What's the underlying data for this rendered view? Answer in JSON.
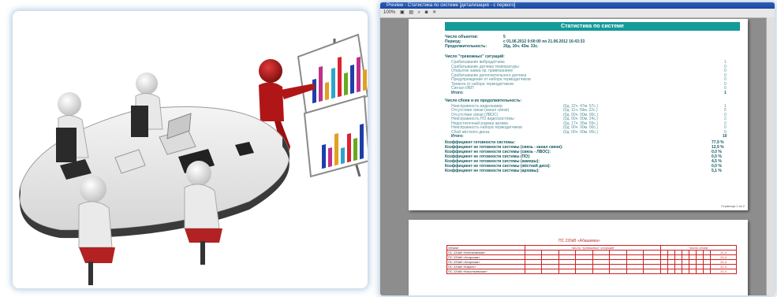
{
  "window": {
    "title": "Preview - Статистика по системе [детализация - с первого]",
    "toolbar": [
      "100%",
      "Print",
      "Save",
      "Zoom",
      "Find",
      "Close"
    ]
  },
  "report": {
    "title": "Статистика по системе",
    "objects_label": "Число объектов:",
    "objects_value": "5",
    "period_label": "Период:",
    "period_value": "с 01.06.2012 0:00:00 по 21.06.2012 16:43:33",
    "duration_label": "Продолжительность:",
    "duration_value": "20д. 16ч. 43м. 33с.",
    "alarms_header": "Число \"тревожных\" ситуаций:",
    "alarms": [
      {
        "label": "Срабатывание вибродатчика",
        "value": "1"
      },
      {
        "label": "Срабатывание датчика температуры",
        "value": "0"
      },
      {
        "label": "Открытие замка пр. привязанием",
        "value": "0"
      },
      {
        "label": "Срабатывание дополнительного датчика",
        "value": "0"
      },
      {
        "label": "Предупреждение от набора термодатчиков",
        "value": "0"
      },
      {
        "label": "Тревога от набора термодатчиков",
        "value": "0"
      },
      {
        "label": "Сигнал ИБП",
        "value": "0"
      }
    ],
    "alarms_total_label": "Итого:",
    "alarms_total": "1",
    "faults_header": "Число сбоев и их продолжительность:",
    "faults": [
      {
        "label": "Неисправность видеокамер",
        "dur": "(0д. 22ч. 47м. 57с.)",
        "value": "1"
      },
      {
        "label": "Отсутствие связи (канал связи)",
        "dur": "(0д. 11ч. 59м. 22с.)",
        "value": "5"
      },
      {
        "label": "Отсутствие связи (ЛВОС)",
        "dur": "(0д. 00ч. 00м. 00с.)",
        "value": "0"
      },
      {
        "label": "Неисправность ПО видеосистемы",
        "dur": "(0д. 00ч. 00м. 24с.)",
        "value": "2"
      },
      {
        "label": "Недостаточный размер архива",
        "dur": "(0д. 17ч. 35м. 55с.)",
        "value": "2"
      },
      {
        "label": "Неисправность набора термодатчиков",
        "dur": "(0д. 00ч. 00м. 00с.)",
        "value": "0"
      },
      {
        "label": "Сбой жёсткого диска",
        "dur": "(0д. 00ч. 00м. 00с.)",
        "value": "0"
      }
    ],
    "faults_total_label": "Итого:",
    "faults_total": "10",
    "coefficients": [
      {
        "label": "Коэффициент готовности системы:",
        "value": "77,9 %"
      },
      {
        "label": "Коэффициент не готовности системы (связь - канал связи):",
        "value": "12,9 %"
      },
      {
        "label": "Коэффициент не готовности системы (связь - ЛВОС):",
        "value": "0,0 %"
      },
      {
        "label": "Коэффициент не готовности системы (ПО):",
        "value": "0,0 %"
      },
      {
        "label": "Коэффициент не готовности системы (камеры):",
        "value": "4,5 %"
      },
      {
        "label": "Коэффициент не готовности системы (жёсткий диск):",
        "value": "0,0 %"
      },
      {
        "label": "Коэффициент не готовности системы (архивы):",
        "value": "5,1 %"
      }
    ],
    "page_no": "Страница 1 из 2"
  },
  "page2": {
    "group_title": "ПС 220кВ «Абашевка»",
    "object_header": "Объект",
    "alarm_header": "Число \"тревожных\" ситуаций",
    "fault_header": "Число сбоев",
    "rows": [
      {
        "name": "ПС 220кВ «Белиховская»",
        "k": "21,4"
      },
      {
        "name": "ПС 220кВ «Атарская»",
        "k": "21,4"
      },
      {
        "name": "ПС 220кВ «Атарская»",
        "k": "21,4"
      },
      {
        "name": "ПС 220кВ «Бирюч»",
        "k": "21,4"
      },
      {
        "name": "ПС 220кВ «Васильевская»",
        "k": "21,4"
      }
    ]
  }
}
